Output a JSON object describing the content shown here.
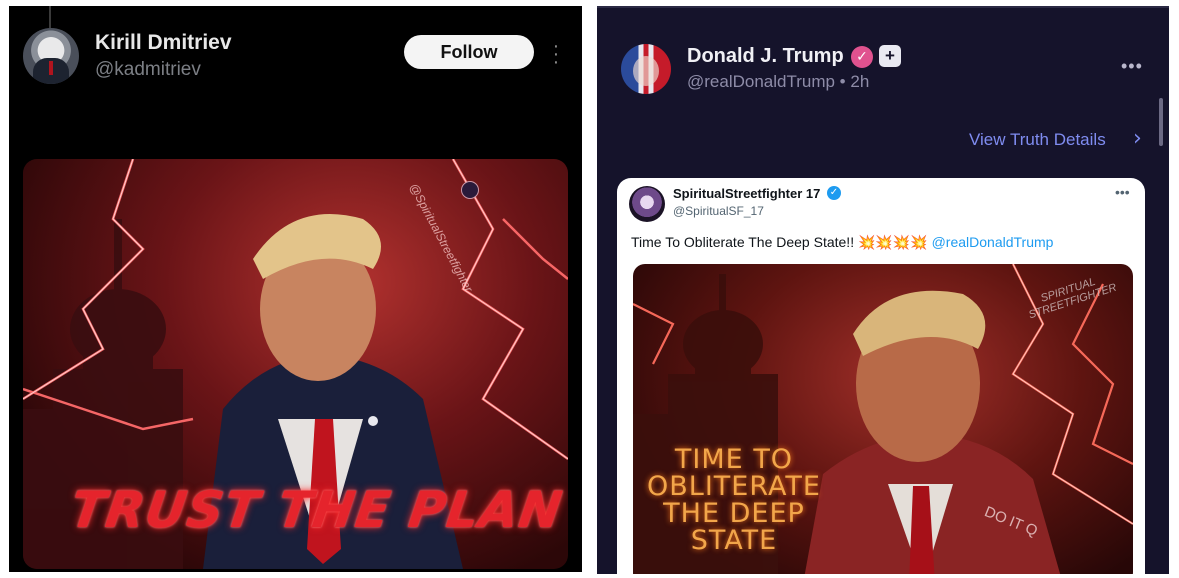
{
  "left_post": {
    "author_name": "Kirill Dmitriev",
    "author_handle": "@kadmitriev",
    "follow_label": "Follow",
    "menu_icon": "vertical-ellipsis-icon",
    "image": {
      "caption_text": "TRUST THE PLAN",
      "watermark": "@SpiritualStreetfighter",
      "accent_color": "#e5242c"
    }
  },
  "right_post": {
    "author_name": "Donald J. Trump",
    "verified_icon": "verified-badge-icon",
    "plus_icon": "plus-badge-icon",
    "author_handle": "@realDonaldTrump • 2h",
    "menu_icon": "horizontal-ellipsis-icon",
    "view_details_label": "View Truth Details",
    "view_details_icon": "chevron-right-icon",
    "accent_color": "#7f8cf0",
    "embedded_tweet": {
      "author_name": "SpiritualStreetfighter 17",
      "author_handle": "@SpiritualSF_17",
      "text": "Time To Obliterate The Deep State!!",
      "emoji": "💥💥💥💥",
      "mention": "@realDonaldTrump",
      "image": {
        "caption_text": "TIME TO OBLITERATE THE DEEP STATE",
        "watermark": "SPIRITUAL STREETFIGHTER",
        "side_text": "DO IT Q"
      }
    }
  }
}
